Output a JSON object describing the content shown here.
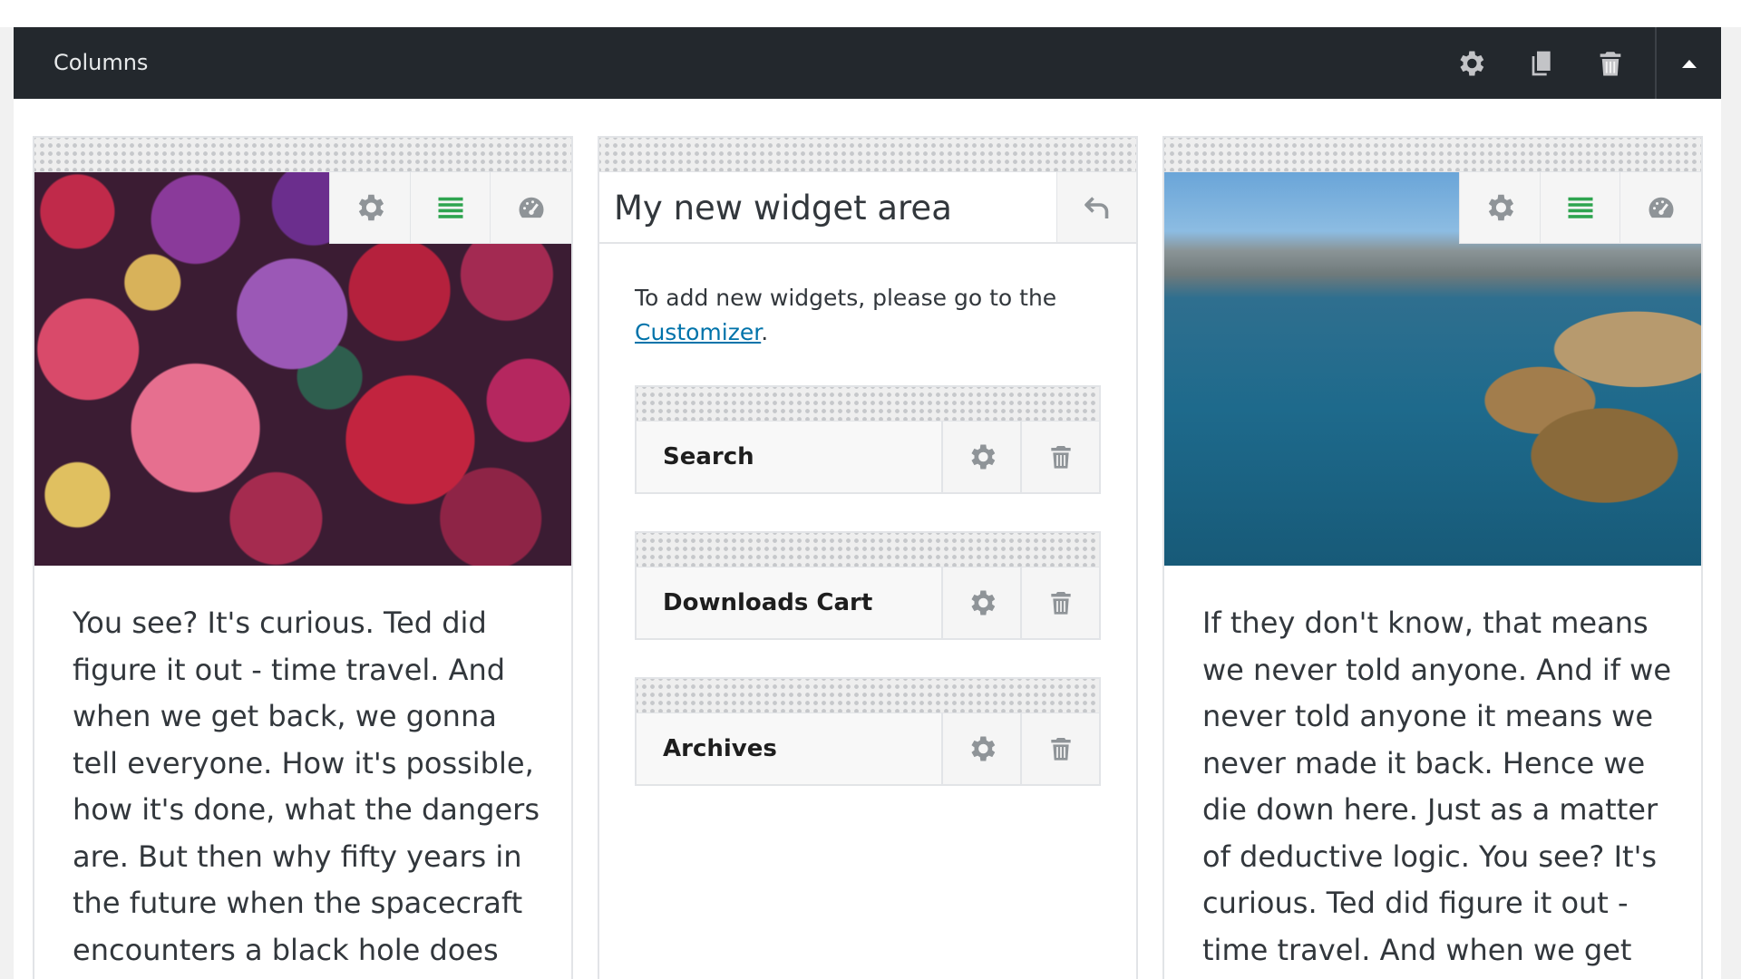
{
  "block": {
    "title": "Columns",
    "icons": [
      "gear-icon",
      "duplicate-icon",
      "trash-icon",
      "collapse-up-icon"
    ]
  },
  "colors": {
    "bar_bg": "#23282d",
    "icon_gray": "#8f9498",
    "icon_green": "#2ea44f",
    "link_blue": "#0073aa",
    "text": "#32373c"
  },
  "left_column": {
    "image": "flowers-photo",
    "toolbar": [
      "gear-icon",
      "align-icon",
      "gauge-icon"
    ],
    "text": "You see? It's curious. Ted did figure it out - time travel. And when we get back, we gonna tell everyone. How it's possible, how it's done, what the dangers are. But then why fifty years in the future when the spacecraft encounters a black hole does"
  },
  "widget_area": {
    "title": "My new widget area",
    "note_prefix": "To add new widgets, please go to the",
    "note_link": "Customizer",
    "note_suffix": ".",
    "widgets": [
      {
        "label": "Search"
      },
      {
        "label": "Downloads Cart"
      },
      {
        "label": "Archives"
      }
    ]
  },
  "right_column": {
    "image": "coastline-photo",
    "toolbar": [
      "gear-icon",
      "align-icon",
      "gauge-icon"
    ],
    "text": "If they don't know, that means we never told anyone. And if we never told anyone it means we never made it back. Hence we die down here. Just as a matter of deductive logic. You see? It's curious. Ted did figure it out - time travel. And when we get"
  }
}
